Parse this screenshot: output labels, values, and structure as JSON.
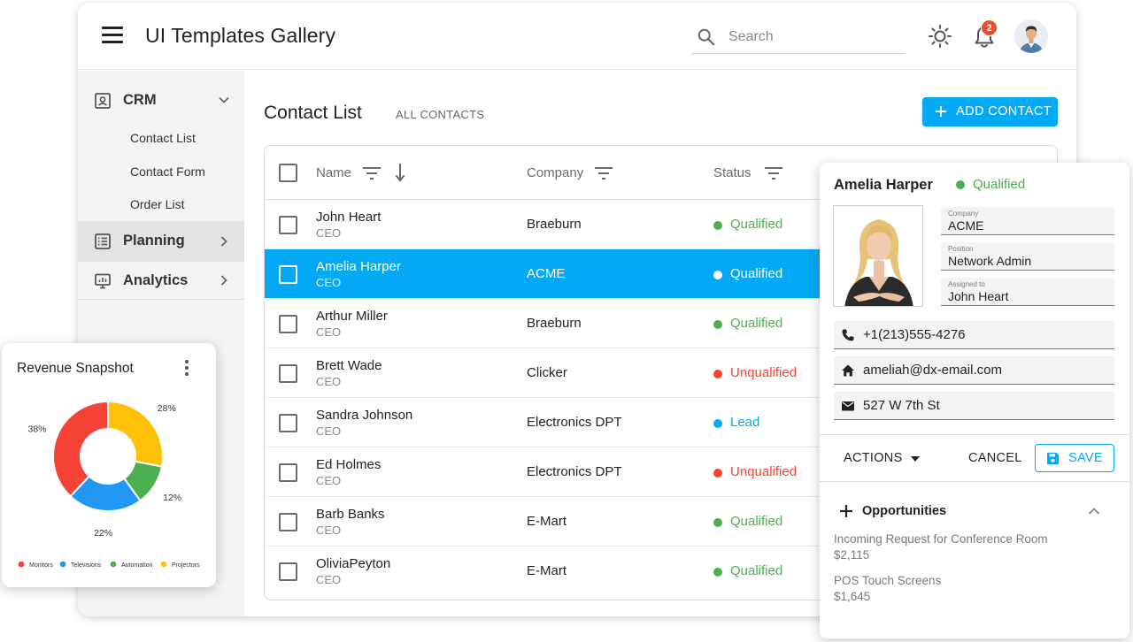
{
  "app": {
    "title": "UI Templates Gallery"
  },
  "search": {
    "placeholder": "Search"
  },
  "notifications": {
    "count": "2"
  },
  "sidebar": {
    "groups": [
      {
        "label": "CRM",
        "icon": "contact-card-icon",
        "expanded": true,
        "items": [
          "Contact List",
          "Contact Form",
          "Order List"
        ]
      },
      {
        "label": "Planning",
        "icon": "list-icon",
        "expanded": false
      },
      {
        "label": "Analytics",
        "icon": "monitor-chart-icon",
        "expanded": false
      }
    ]
  },
  "page": {
    "title": "Contact List",
    "subtitle": "ALL CONTACTS",
    "add_label": "ADD CONTACT"
  },
  "grid": {
    "columns": [
      "Name",
      "Company",
      "Status"
    ],
    "rows": [
      {
        "name": "John Heart",
        "position": "CEO",
        "company": "Braeburn",
        "status": "Qualified"
      },
      {
        "name": "Amelia Harper",
        "position": "CEO",
        "company": "ACME",
        "status": "Qualified",
        "selected": true
      },
      {
        "name": "Arthur Miller",
        "position": "CEO",
        "company": "Braeburn",
        "status": "Qualified"
      },
      {
        "name": "Brett Wade",
        "position": "CEO",
        "company": "Clicker",
        "status": "Unqualified"
      },
      {
        "name": "Sandra Johnson",
        "position": "CEO",
        "company": "Electronics DPT",
        "status": "Lead"
      },
      {
        "name": "Ed Holmes",
        "position": "CEO",
        "company": "Electronics DPT",
        "status": "Unqualified"
      },
      {
        "name": "Barb Banks",
        "position": "CEO",
        "company": "E-Mart",
        "status": "Qualified"
      },
      {
        "name": "OliviaPeyton",
        "position": "CEO",
        "company": "E-Mart",
        "status": "Qualified"
      }
    ]
  },
  "status_colors": {
    "Qualified": "#4caf50",
    "Unqualified": "#f44336",
    "Lead": "#03a9f4"
  },
  "card": {
    "name": "Amelia Harper",
    "status": "Qualified",
    "fields": [
      {
        "caption": "Company",
        "value": "ACME"
      },
      {
        "caption": "Position",
        "value": "Network Admin"
      },
      {
        "caption": "Assigned to",
        "value": "John Heart"
      }
    ],
    "phone": "+1(213)555-4276",
    "email": "ameliah@dx-email.com",
    "address": "527 W 7th St",
    "actions_label": "ACTIONS",
    "cancel_label": "CANCEL",
    "save_label": "SAVE",
    "opportunities_title": "Opportunities",
    "opportunities": [
      {
        "name": "Incoming Request for Conference Room",
        "amount": "$2,115"
      },
      {
        "name": "POS Touch Screens",
        "amount": "$1,645"
      }
    ]
  },
  "revenue": {
    "title": "Revenue Snapshot",
    "chart_data": {
      "type": "pie",
      "title": "Revenue Snapshot",
      "categories": [
        "Monitors",
        "Televisions",
        "Automation",
        "Projectors"
      ],
      "values": [
        38,
        22,
        12,
        28
      ],
      "labels": [
        "38%",
        "22%",
        "12%",
        "28%"
      ],
      "colors": [
        "#f44336",
        "#2196f3",
        "#4caf50",
        "#ffc107"
      ],
      "legend": "bottom"
    }
  },
  "accent": "#03a9f4"
}
